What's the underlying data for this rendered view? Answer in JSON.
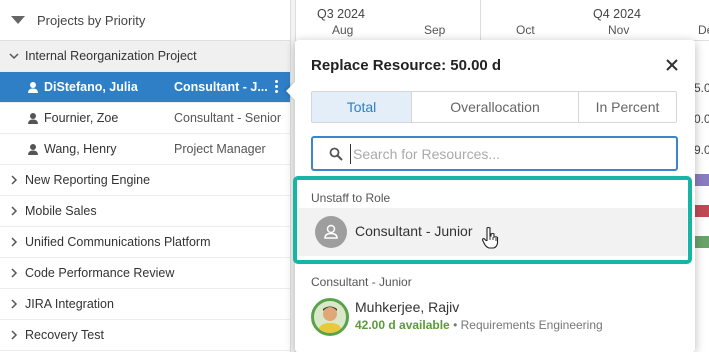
{
  "tree": {
    "header_title": "Projects by Priority",
    "rows": [
      {
        "label": "Internal Reorganization Project",
        "expanded": true
      },
      {
        "name": "DiStefano, Julia",
        "role": "Consultant - J...",
        "selected": true
      },
      {
        "name": "Fournier, Zoe",
        "role": "Consultant - Senior"
      },
      {
        "name": "Wang, Henry",
        "role": "Project Manager"
      },
      {
        "label": "New Reporting Engine"
      },
      {
        "label": "Mobile Sales"
      },
      {
        "label": "Unified Communications Platform"
      },
      {
        "label": "Code Performance Review"
      },
      {
        "label": "JIRA Integration"
      },
      {
        "label": "Recovery Test"
      }
    ]
  },
  "timeline": {
    "quarters": [
      "Q3 2024",
      "Q4 2024"
    ],
    "months": [
      "Aug",
      "Sep",
      "Oct",
      "Nov",
      "De"
    ],
    "values": [
      "5.0",
      "0.0",
      "9.0"
    ]
  },
  "popup": {
    "title": "Replace Resource: 50.00 d",
    "tabs": [
      "Total",
      "Overallocation",
      "In Percent"
    ],
    "active_tab": "Total",
    "search_placeholder": "Search for Resources...",
    "unstaff_label": "Unstaff to Role",
    "unstaff_role": "Consultant - Junior",
    "group_label": "Consultant - Junior",
    "resource": {
      "name": "Muhkerjee, Rajiv",
      "available": "42.00 d available",
      "separator": " • ",
      "department": "Requirements Engineering"
    }
  },
  "colors": {
    "selection": "#2f7fc7",
    "highlight": "#17b5a5",
    "available": "#5a9a3a"
  }
}
